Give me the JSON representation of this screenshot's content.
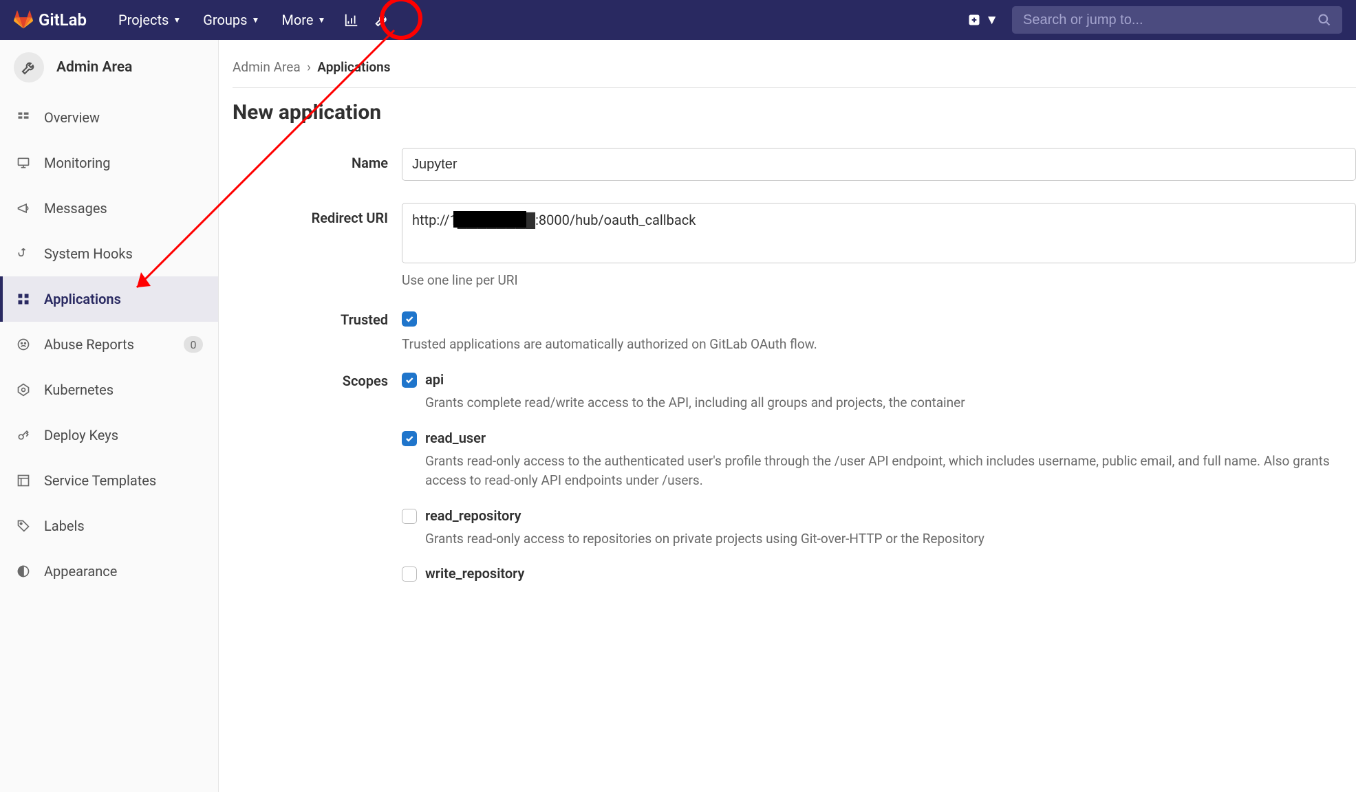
{
  "topnav": {
    "brand": "GitLab",
    "items": [
      {
        "label": "Projects"
      },
      {
        "label": "Groups"
      },
      {
        "label": "More"
      }
    ],
    "search_placeholder": "Search or jump to..."
  },
  "sidebar": {
    "title": "Admin Area",
    "items": [
      {
        "icon": "dashboard",
        "label": "Overview",
        "active": false
      },
      {
        "icon": "monitor",
        "label": "Monitoring",
        "active": false
      },
      {
        "icon": "megaphone",
        "label": "Messages",
        "active": false
      },
      {
        "icon": "hook",
        "label": "System Hooks",
        "active": false
      },
      {
        "icon": "apps",
        "label": "Applications",
        "active": true
      },
      {
        "icon": "face",
        "label": "Abuse Reports",
        "active": false,
        "badge": "0"
      },
      {
        "icon": "kube",
        "label": "Kubernetes",
        "active": false
      },
      {
        "icon": "key",
        "label": "Deploy Keys",
        "active": false
      },
      {
        "icon": "template",
        "label": "Service Templates",
        "active": false
      },
      {
        "icon": "tag",
        "label": "Labels",
        "active": false
      },
      {
        "icon": "appearance",
        "label": "Appearance",
        "active": false
      }
    ]
  },
  "breadcrumb": {
    "root": "Admin Area",
    "sep": "›",
    "current": "Applications"
  },
  "page": {
    "title": "New application"
  },
  "form": {
    "name": {
      "label": "Name",
      "value": "Jupyter"
    },
    "redirect": {
      "label": "Redirect URI",
      "value": "http://1████████:8000/hub/oauth_callback",
      "hint": "Use one line per URI"
    },
    "trusted": {
      "label": "Trusted",
      "checked": true,
      "hint": "Trusted applications are automatically authorized on GitLab OAuth flow."
    },
    "scopes": {
      "label": "Scopes",
      "items": [
        {
          "name": "api",
          "checked": true,
          "desc": "Grants complete read/write access to the API, including all groups and projects, the container"
        },
        {
          "name": "read_user",
          "checked": true,
          "desc": "Grants read-only access to the authenticated user's profile through the /user API endpoint, which includes username, public email, and full name. Also grants access to read-only API endpoints under /users."
        },
        {
          "name": "read_repository",
          "checked": false,
          "desc": "Grants read-only access to repositories on private projects using Git-over-HTTP or the Repository"
        },
        {
          "name": "write_repository",
          "checked": false,
          "desc": ""
        }
      ]
    }
  }
}
